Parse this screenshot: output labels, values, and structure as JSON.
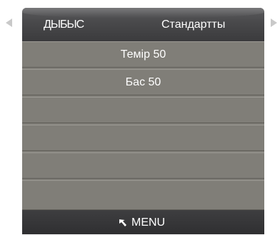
{
  "header": {
    "title": "ДЫБЫС",
    "value": "Стандартты"
  },
  "menu": {
    "items": [
      {
        "label": "Темір 50"
      },
      {
        "label": "Бас 50"
      },
      {
        "label": ""
      },
      {
        "label": ""
      },
      {
        "label": ""
      },
      {
        "label": ""
      }
    ]
  },
  "footer": {
    "back_icon": "return-arrow-icon",
    "label": "MENU"
  },
  "colors": {
    "panel": "#807e78",
    "header": "#4a4a4c",
    "footer": "#333335",
    "text": "#ffffff",
    "arrows": "#c9c9c9"
  }
}
